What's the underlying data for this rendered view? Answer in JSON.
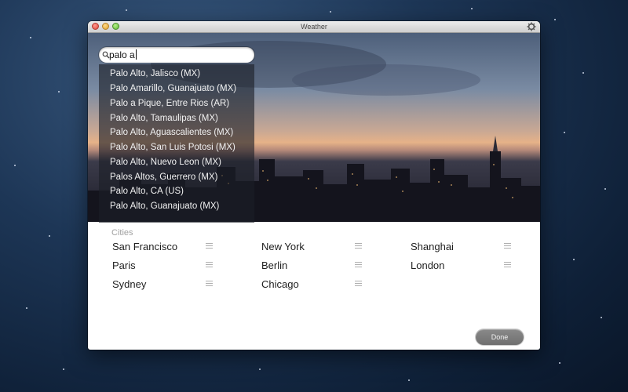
{
  "window": {
    "title": "Weather"
  },
  "search": {
    "value": "palo a"
  },
  "suggestions": [
    "Palo Alto, Jalisco (MX)",
    "Palo Amarillo, Guanajuato (MX)",
    "Palo a Pique, Entre Rios (AR)",
    "Palo Alto, Tamaulipas (MX)",
    "Palo Alto, Aguascalientes (MX)",
    "Palo Alto, San Luis Potosi (MX)",
    "Palo Alto, Nuevo Leon (MX)",
    "Palos Altos, Guerrero (MX)",
    "Palo Alto, CA (US)",
    "Palo Alto, Guanajuato (MX)"
  ],
  "cities": {
    "title": "Cities",
    "items": [
      "San Francisco",
      "New York",
      "Shanghai",
      "Paris",
      "Berlin",
      "London",
      "Sydney",
      "Chicago"
    ]
  },
  "footer": {
    "done_label": "Done"
  },
  "icons": {
    "search": "search-icon",
    "gear": "gear-icon",
    "handle": "drag-handle-icon"
  },
  "colors": {
    "desktop": "#1d3656",
    "done_button": "#7a7a7a",
    "suggestion_panel": "#1c1e26"
  }
}
